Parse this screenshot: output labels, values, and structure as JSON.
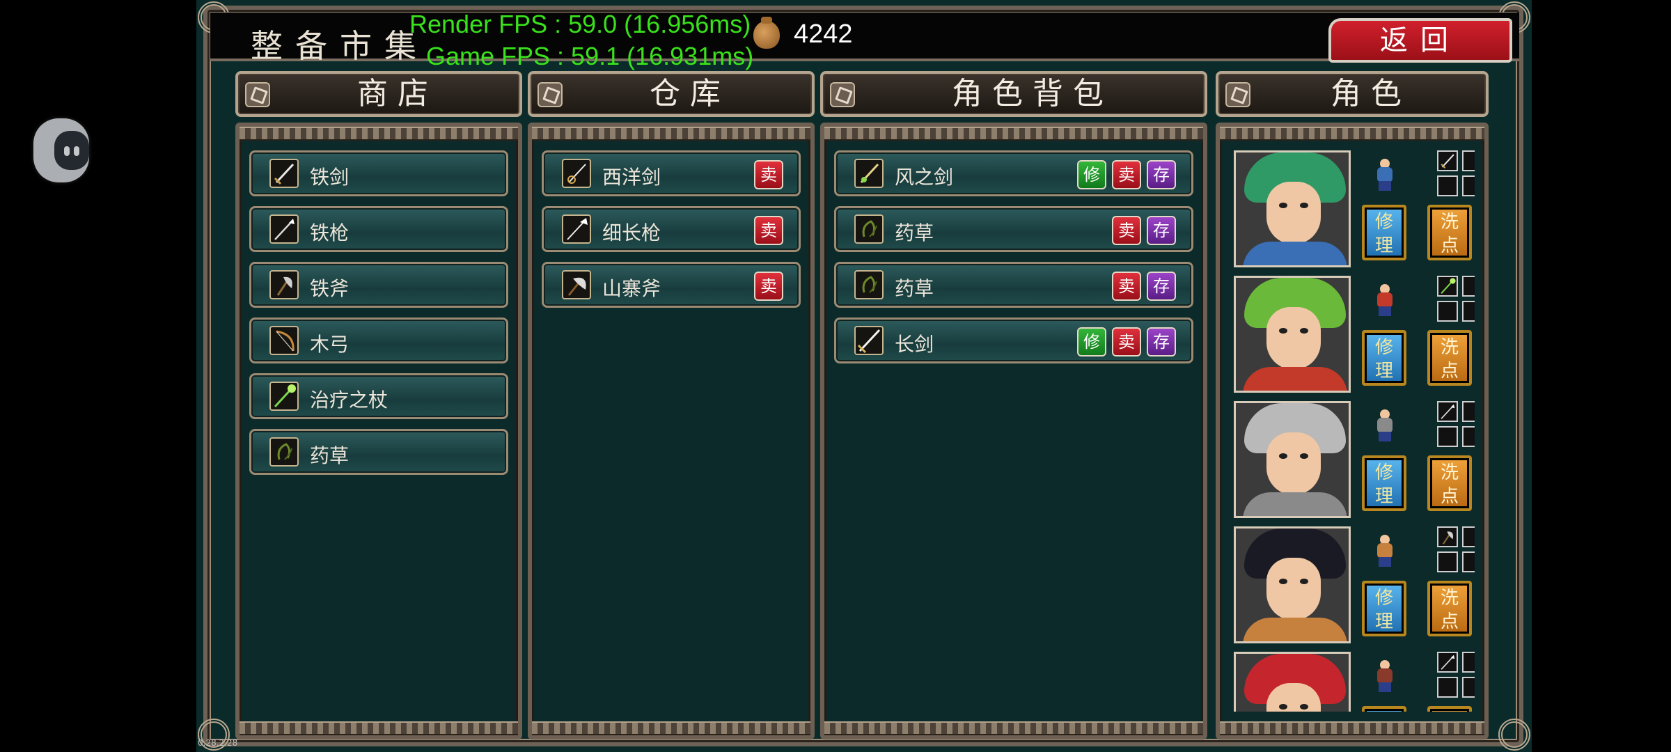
{
  "overlay": {
    "render_fps": "Render FPS : 59.0 (16.956ms)",
    "game_fps": "Game FPS : 59.1 (16.931ms)",
    "version": "0.28.2.28"
  },
  "header": {
    "title": "整备市集",
    "gold": "4242",
    "back_label": "返回"
  },
  "panels": {
    "shop": {
      "title": "商 店",
      "items": [
        {
          "name": "铁剑",
          "icon": "sword-icon"
        },
        {
          "name": "铁枪",
          "icon": "lance-icon"
        },
        {
          "name": "铁斧",
          "icon": "axe-icon"
        },
        {
          "name": "木弓",
          "icon": "bow-icon"
        },
        {
          "name": "治疗之杖",
          "icon": "heal-staff-icon"
        },
        {
          "name": "药草",
          "icon": "herb-icon"
        }
      ]
    },
    "warehouse": {
      "title": "仓 库",
      "items": [
        {
          "name": "西洋剑",
          "icon": "rapier-icon",
          "sell": "卖"
        },
        {
          "name": "细长枪",
          "icon": "slim-lance-icon",
          "sell": "卖"
        },
        {
          "name": "山寨斧",
          "icon": "hand-axe-icon",
          "sell": "卖"
        }
      ]
    },
    "bag": {
      "title": "角 色 背 包",
      "items": [
        {
          "name": "风之剑",
          "icon": "wind-sword-icon",
          "repair": "修",
          "sell": "卖",
          "store": "存"
        },
        {
          "name": "药草",
          "icon": "herb-icon",
          "sell": "卖",
          "store": "存"
        },
        {
          "name": "药草",
          "icon": "herb-icon",
          "sell": "卖",
          "store": "存"
        },
        {
          "name": "长剑",
          "icon": "long-sword-icon",
          "repair": "修",
          "sell": "卖",
          "store": "存"
        }
      ]
    },
    "characters": {
      "title": "角 色",
      "repair_label": "修理",
      "reset_label": "洗点",
      "list": [
        {
          "portrait": "green-hair-knight-portrait",
          "hair": "#2f9a66",
          "armor": "#3a6fb5",
          "slots": [
            "sword-icon",
            "",
            "",
            ""
          ]
        },
        {
          "portrait": "green-hair-mage-portrait",
          "hair": "#6ab93a",
          "armor": "#c43a2a",
          "slots": [
            "heal-staff-icon",
            "",
            "",
            ""
          ]
        },
        {
          "portrait": "armored-knight-portrait",
          "hair": "#b9b9b9",
          "armor": "#8a8a8a",
          "slots": [
            "lance-icon",
            "",
            "",
            ""
          ]
        },
        {
          "portrait": "dark-hair-fighter-portrait",
          "hair": "#1a1a24",
          "armor": "#c6813f",
          "slots": [
            "axe-icon",
            "",
            "",
            ""
          ]
        },
        {
          "portrait": "red-hair-warrior-portrait",
          "hair": "#c5262e",
          "armor": "#8a3a2a",
          "slots": [
            "lance-icon",
            "",
            "",
            ""
          ]
        }
      ]
    }
  }
}
